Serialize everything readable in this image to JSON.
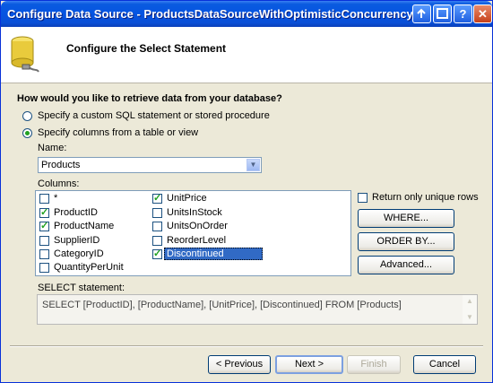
{
  "window": {
    "title": "Configure Data Source - ProductsDataSourceWithOptimisticConcurrency",
    "controls": {
      "help_label": "?",
      "close_label": "✕"
    }
  },
  "header": {
    "title": "Configure the Select Statement"
  },
  "question": "How would you like to retrieve data from your database?",
  "options": [
    {
      "label": "Specify a custom SQL statement or stored procedure",
      "selected": false
    },
    {
      "label": "Specify columns from a table or view",
      "selected": true
    }
  ],
  "name_label": "Name:",
  "table_name": "Products",
  "columns_label": "Columns:",
  "columns": [
    {
      "label": "*",
      "checked": false
    },
    {
      "label": "ProductID",
      "checked": true
    },
    {
      "label": "ProductName",
      "checked": true
    },
    {
      "label": "SupplierID",
      "checked": false
    },
    {
      "label": "CategoryID",
      "checked": false
    },
    {
      "label": "QuantityPerUnit",
      "checked": false
    },
    {
      "label": "UnitPrice",
      "checked": true
    },
    {
      "label": "UnitsInStock",
      "checked": false
    },
    {
      "label": "UnitsOnOrder",
      "checked": false
    },
    {
      "label": "ReorderLevel",
      "checked": false
    },
    {
      "label": "Discontinued",
      "checked": true
    }
  ],
  "unique_rows_label": "Return only unique rows",
  "buttons": {
    "where": "WHERE...",
    "order_by": "ORDER BY...",
    "advanced": "Advanced...",
    "previous": "< Previous",
    "next": "Next >",
    "finish": "Finish",
    "cancel": "Cancel"
  },
  "select_label": "SELECT statement:",
  "select_statement": "SELECT [ProductID], [ProductName], [UnitPrice], [Discontinued] FROM [Products]",
  "colors": {
    "title_bar": "#0554e2",
    "selection": "#316ac5",
    "check": "#21a121"
  }
}
